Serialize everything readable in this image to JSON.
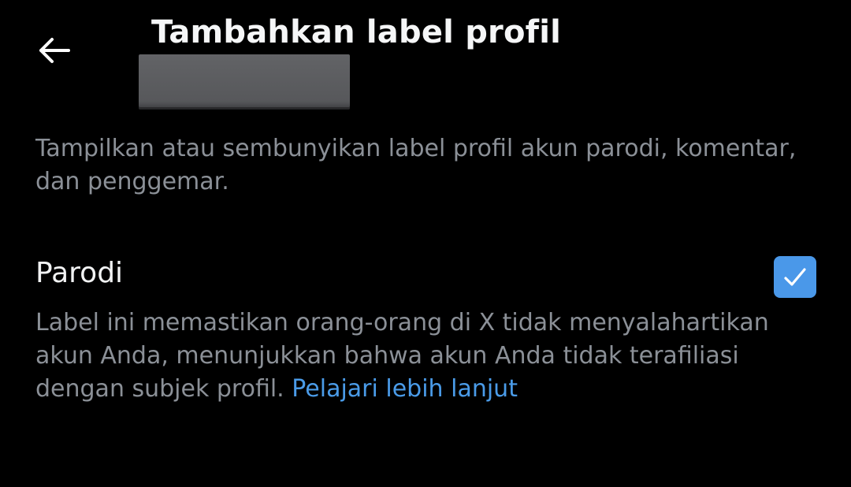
{
  "header": {
    "title": "Tambahkan label profil",
    "back_icon": "arrow-left-icon"
  },
  "description": "Tampilkan atau sembunyikan label profil akun parodi, komentar, dan penggemar.",
  "option": {
    "title": "Parodi",
    "checked": true,
    "checkbox_icon": "checkmark-icon",
    "description": "Label ini memastikan orang-orang di X tidak menyalahartikan akun Anda, menunjukkan bahwa akun Anda tidak terafiliasi dengan subjek profil.",
    "link_text": "Pelajari lebih lanjut"
  },
  "colors": {
    "background": "#000000",
    "accent": "#4a98e9",
    "secondary_text": "#8b9097"
  }
}
